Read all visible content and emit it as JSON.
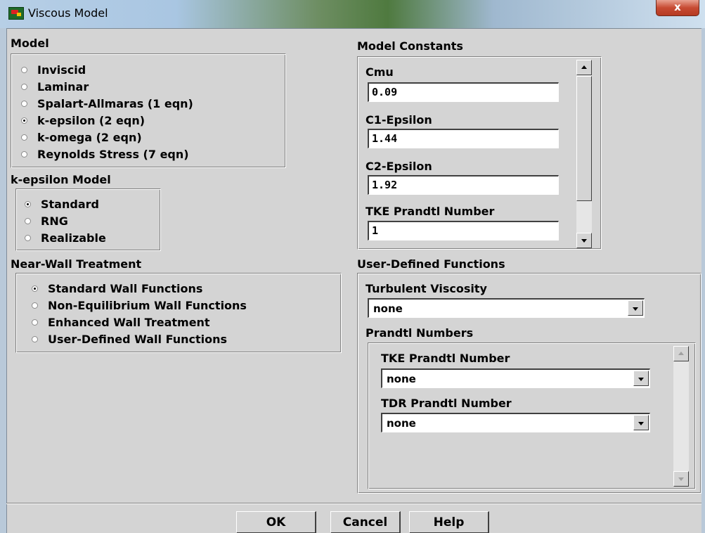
{
  "window": {
    "title": "Viscous Model",
    "close_label": "x"
  },
  "model": {
    "heading": "Model",
    "options": [
      {
        "label": "Inviscid",
        "selected": false
      },
      {
        "label": "Laminar",
        "selected": false
      },
      {
        "label": "Spalart-Allmaras  (1 eqn)",
        "selected": false
      },
      {
        "label": "k-epsilon  (2 eqn)",
        "selected": true
      },
      {
        "label": "k-omega  (2 eqn)",
        "selected": false
      },
      {
        "label": "Reynolds Stress  (7 eqn)",
        "selected": false
      }
    ]
  },
  "kepsilon": {
    "heading": "k-epsilon Model",
    "options": [
      {
        "label": "Standard",
        "selected": true
      },
      {
        "label": "RNG",
        "selected": false
      },
      {
        "label": "Realizable",
        "selected": false
      }
    ]
  },
  "nearwall": {
    "heading": "Near-Wall Treatment",
    "options": [
      {
        "label": "Standard Wall Functions",
        "selected": true
      },
      {
        "label": "Non-Equilibrium Wall Functions",
        "selected": false
      },
      {
        "label": "Enhanced Wall Treatment",
        "selected": false
      },
      {
        "label": "User-Defined Wall Functions",
        "selected": false
      }
    ]
  },
  "constants": {
    "heading": "Model Constants",
    "items": [
      {
        "label": "Cmu",
        "value": "0.09"
      },
      {
        "label": "C1-Epsilon",
        "value": "1.44"
      },
      {
        "label": "C2-Epsilon",
        "value": "1.92"
      },
      {
        "label": "TKE Prandtl Number",
        "value": "1"
      }
    ]
  },
  "udf": {
    "heading": "User-Defined Functions",
    "turb_visc_label": "Turbulent Viscosity",
    "turb_visc_value": "none",
    "prandtl_heading": "Prandtl Numbers",
    "tke_label": "TKE Prandtl Number",
    "tke_value": "none",
    "tdr_label": "TDR Prandtl Number",
    "tdr_value": "none"
  },
  "buttons": {
    "ok": "OK",
    "cancel": "Cancel",
    "help": "Help"
  }
}
